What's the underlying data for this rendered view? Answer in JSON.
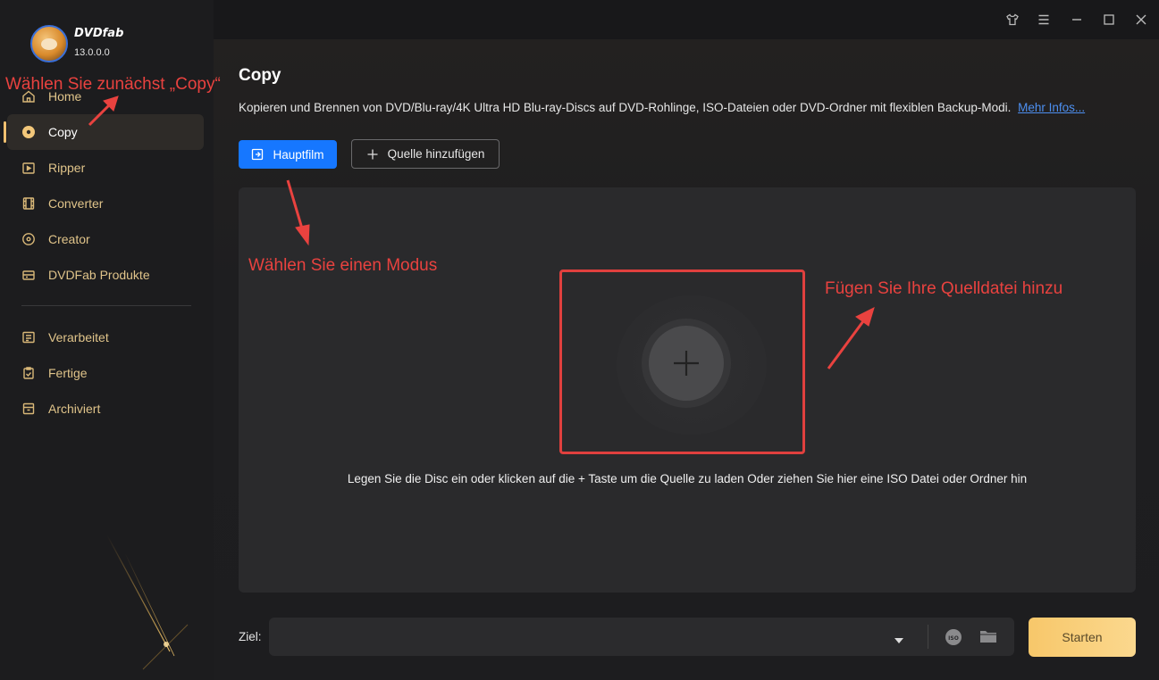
{
  "app": {
    "brand": "DVDfab",
    "version": "13.0.0.0"
  },
  "sidebar": {
    "items": [
      {
        "label": "Home",
        "icon": "home-icon"
      },
      {
        "label": "Copy",
        "icon": "disc-icon",
        "active": true
      },
      {
        "label": "Ripper",
        "icon": "ripper-icon"
      },
      {
        "label": "Converter",
        "icon": "film-icon"
      },
      {
        "label": "Creator",
        "icon": "creator-disc-icon"
      },
      {
        "label": "DVDFab Produkte",
        "icon": "products-icon"
      }
    ],
    "tasks": [
      {
        "label": "Verarbeitet",
        "icon": "processing-list-icon"
      },
      {
        "label": "Fertige",
        "icon": "clipboard-check-icon"
      },
      {
        "label": "Archiviert",
        "icon": "archive-icon"
      }
    ]
  },
  "main": {
    "title": "Copy",
    "description": "Kopieren und Brennen von DVD/Blu-ray/4K Ultra HD Blu-ray-Discs auf DVD-Rohlinge, ISO-Dateien oder DVD-Ordner mit flexiblen Backup-Modi.",
    "more_link": "Mehr Infos...",
    "mode_button": "Hauptfilm",
    "add_source_button": "Quelle hinzufügen",
    "drop_hint": "Legen Sie die Disc ein oder klicken auf die + Taste um die Quelle zu laden Oder ziehen Sie hier eine ISO Datei oder Ordner hin"
  },
  "bottom": {
    "target_label": "Ziel:",
    "target_value": "",
    "start_button": "Starten"
  },
  "annotations": {
    "copy_hint": "Wählen Sie zunächst „Copy“",
    "mode_hint": "Wählen Sie einen Modus",
    "source_hint": "Fügen Sie Ihre Quelldatei hinzu"
  },
  "colors": {
    "accent": "#1677ff",
    "gold": "#e0c48a",
    "annotation": "#e9423f",
    "start": "#f7c76a"
  }
}
